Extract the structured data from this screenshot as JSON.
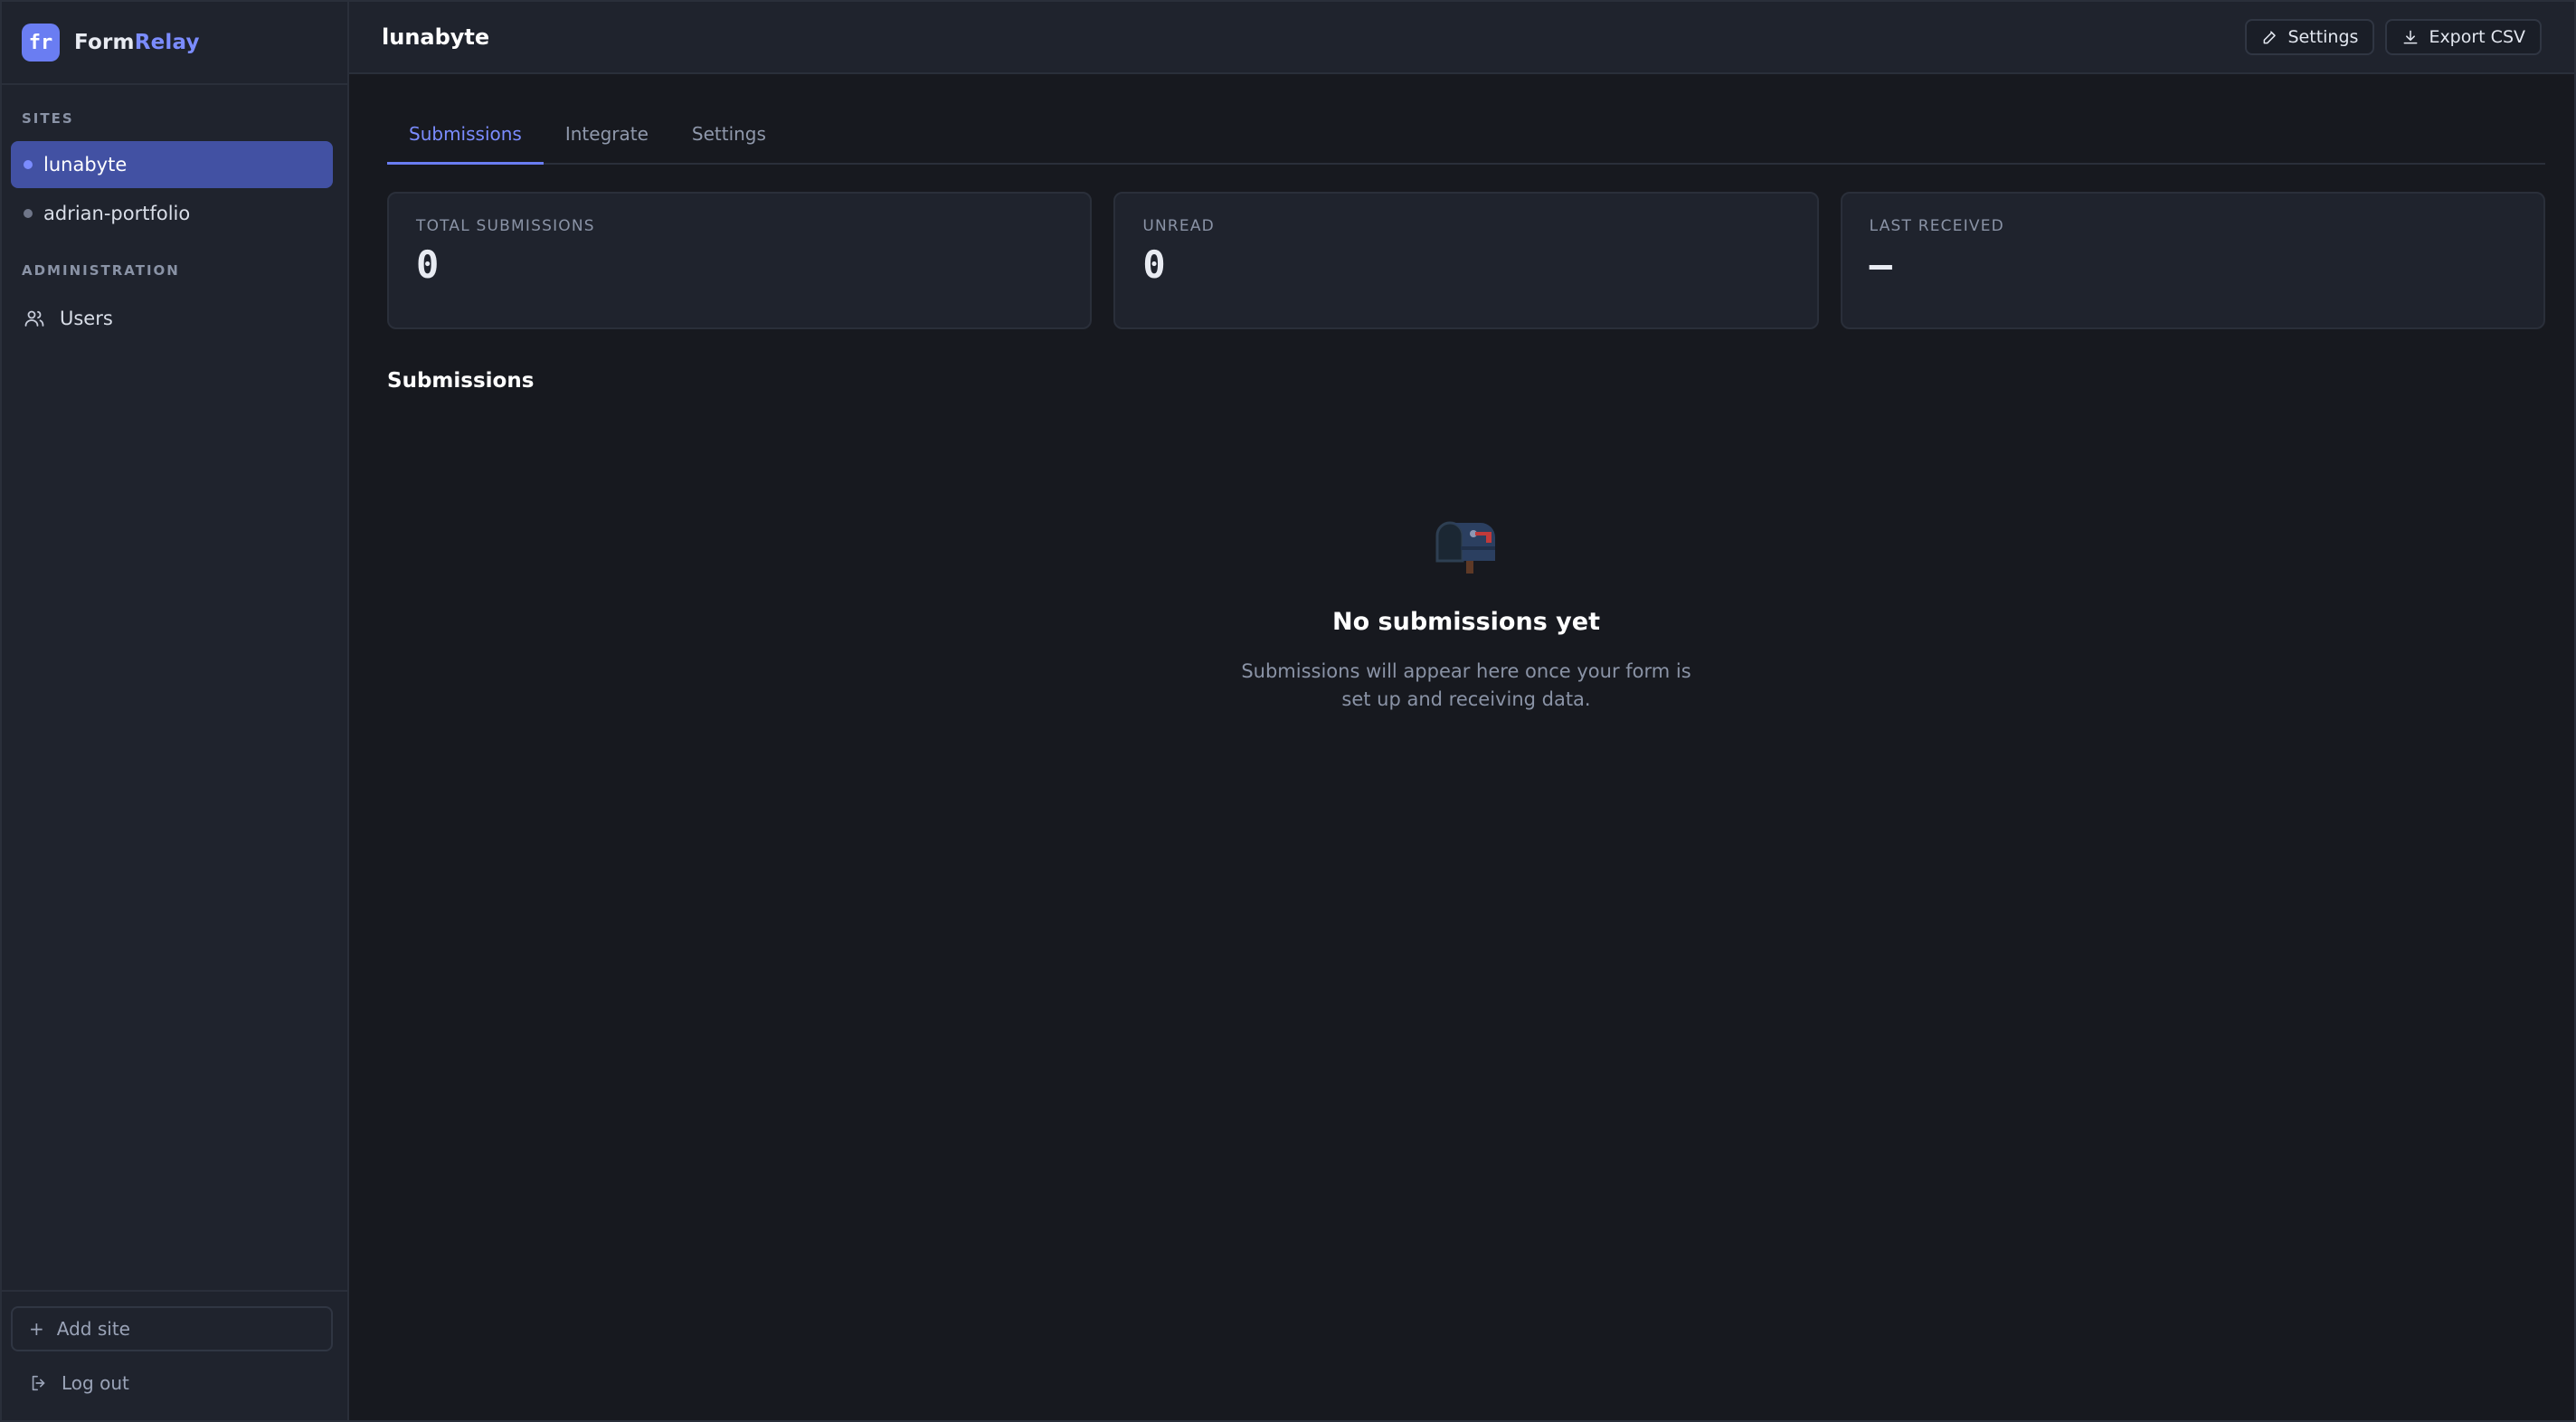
{
  "brand": {
    "logo_text": "fr",
    "name_part1": "Form",
    "name_part2": "Relay",
    "accent_color": "#7b8cff"
  },
  "sidebar": {
    "sites_label": "SITES",
    "sites": [
      {
        "label": "lunabyte",
        "active": true
      },
      {
        "label": "adrian-portfolio",
        "active": false
      }
    ],
    "admin_label": "ADMINISTRATION",
    "admin_items": [
      {
        "label": "Users",
        "icon": "users-icon"
      }
    ],
    "add_site_label": "Add site",
    "logout_label": "Log out"
  },
  "header": {
    "title": "lunabyte",
    "settings_label": "Settings",
    "export_label": "Export CSV"
  },
  "tabs": [
    {
      "label": "Submissions",
      "active": true
    },
    {
      "label": "Integrate",
      "active": false
    },
    {
      "label": "Settings",
      "active": false
    }
  ],
  "stats": [
    {
      "label": "TOTAL SUBMISSIONS",
      "value": "0"
    },
    {
      "label": "UNREAD",
      "value": "0"
    },
    {
      "label": "LAST RECEIVED",
      "value": "–"
    }
  ],
  "submissions": {
    "title": "Submissions",
    "empty_title": "No submissions yet",
    "empty_description": "Submissions will appear here once your form is set up and receiving data.",
    "empty_icon": "mailbox-icon"
  }
}
